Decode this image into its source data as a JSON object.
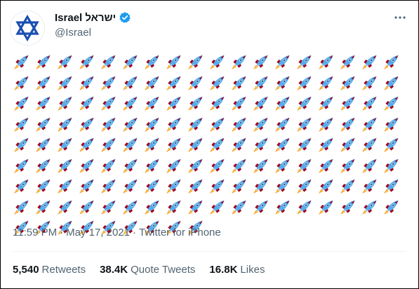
{
  "tweet": {
    "display_name": "Israel ישראל",
    "handle": "@Israel",
    "rocket_count": 153,
    "rocket_columns": 18,
    "timestamp": "11:59 PM",
    "date": "May 17, 2021",
    "source": "Twitter for iPhone",
    "separator": "·"
  },
  "stats": {
    "retweets_count": "5,540",
    "retweets_label": "Retweets",
    "quotes_count": "38.4K",
    "quotes_label": "Quote Tweets",
    "likes_count": "16.8K",
    "likes_label": "Likes"
  },
  "icons": {
    "avatar": "star-of-david-icon",
    "verified": "verified-badge-icon",
    "more": "more-options-icon",
    "rocket": "rocket-icon"
  },
  "colors": {
    "accent": "#1d9bf0",
    "star": "#1a4fb0",
    "text": "#0f1419",
    "secondary": "#536471"
  }
}
